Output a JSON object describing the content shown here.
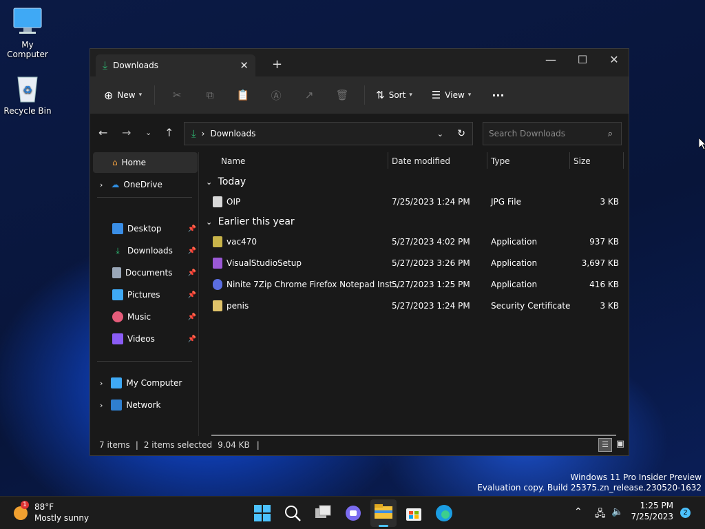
{
  "desktop": {
    "icons": [
      {
        "label": "My Computer"
      },
      {
        "label": "Recycle Bin"
      }
    ],
    "watermark": {
      "line1": "Windows 11 Pro Insider Preview",
      "line2": "Evaluation copy. Build 25375.zn_release.230520-1632"
    }
  },
  "window": {
    "tab_title": "Downloads",
    "tab_close": "✕",
    "new_tab": "+",
    "controls": {
      "minimize": "—",
      "maximize": "☐",
      "close": "✕"
    },
    "toolbar": {
      "new_label": "New",
      "sort_label": "Sort",
      "view_label": "View",
      "more_label": "···"
    },
    "address": {
      "separator": "›",
      "location": "Downloads",
      "search_placeholder": "Search Downloads"
    },
    "sidebar": {
      "home": "Home",
      "onedrive": "OneDrive",
      "pinned": [
        {
          "label": "Desktop",
          "color": "#3a8ee6"
        },
        {
          "label": "Downloads",
          "color": "#2eb872"
        },
        {
          "label": "Documents",
          "color": "#9aa7b8"
        },
        {
          "label": "Pictures",
          "color": "#3fa9f5"
        },
        {
          "label": "Music",
          "color": "#e55c7a"
        },
        {
          "label": "Videos",
          "color": "#8a5cf5"
        }
      ],
      "my_computer": "My Computer",
      "network": "Network"
    },
    "columns": {
      "name": "Name",
      "date": "Date modified",
      "type": "Type",
      "size": "Size"
    },
    "groups": [
      {
        "label": "Today",
        "files": [
          {
            "name": "OIP",
            "date": "7/25/2023 1:24 PM",
            "type": "JPG File",
            "size": "3 KB",
            "icon_color": "#d8d8d8"
          }
        ]
      },
      {
        "label": "Earlier this year",
        "files": [
          {
            "name": "vac470",
            "date": "5/27/2023 4:02 PM",
            "type": "Application",
            "size": "937 KB",
            "icon_color": "#c9b44a"
          },
          {
            "name": "VisualStudioSetup",
            "date": "5/27/2023 3:26 PM",
            "type": "Application",
            "size": "3,697 KB",
            "icon_color": "#9b59d6"
          },
          {
            "name": "Ninite 7Zip Chrome Firefox Notepad Inst...",
            "date": "5/27/2023 1:25 PM",
            "type": "Application",
            "size": "416 KB",
            "icon_color": "#5b6ee1"
          },
          {
            "name": "penis",
            "date": "5/27/2023 1:24 PM",
            "type": "Security Certificate",
            "size": "3 KB",
            "icon_color": "#e0c36a"
          }
        ]
      }
    ],
    "status": {
      "items": "7 items",
      "selected": "2 items selected",
      "size": "9.04 KB"
    }
  },
  "taskbar": {
    "weather_temp": "88°F",
    "weather_desc": "Mostly sunny",
    "weather_badge": "1",
    "time": "1:25 PM",
    "date": "7/25/2023",
    "notification_count": "2"
  }
}
